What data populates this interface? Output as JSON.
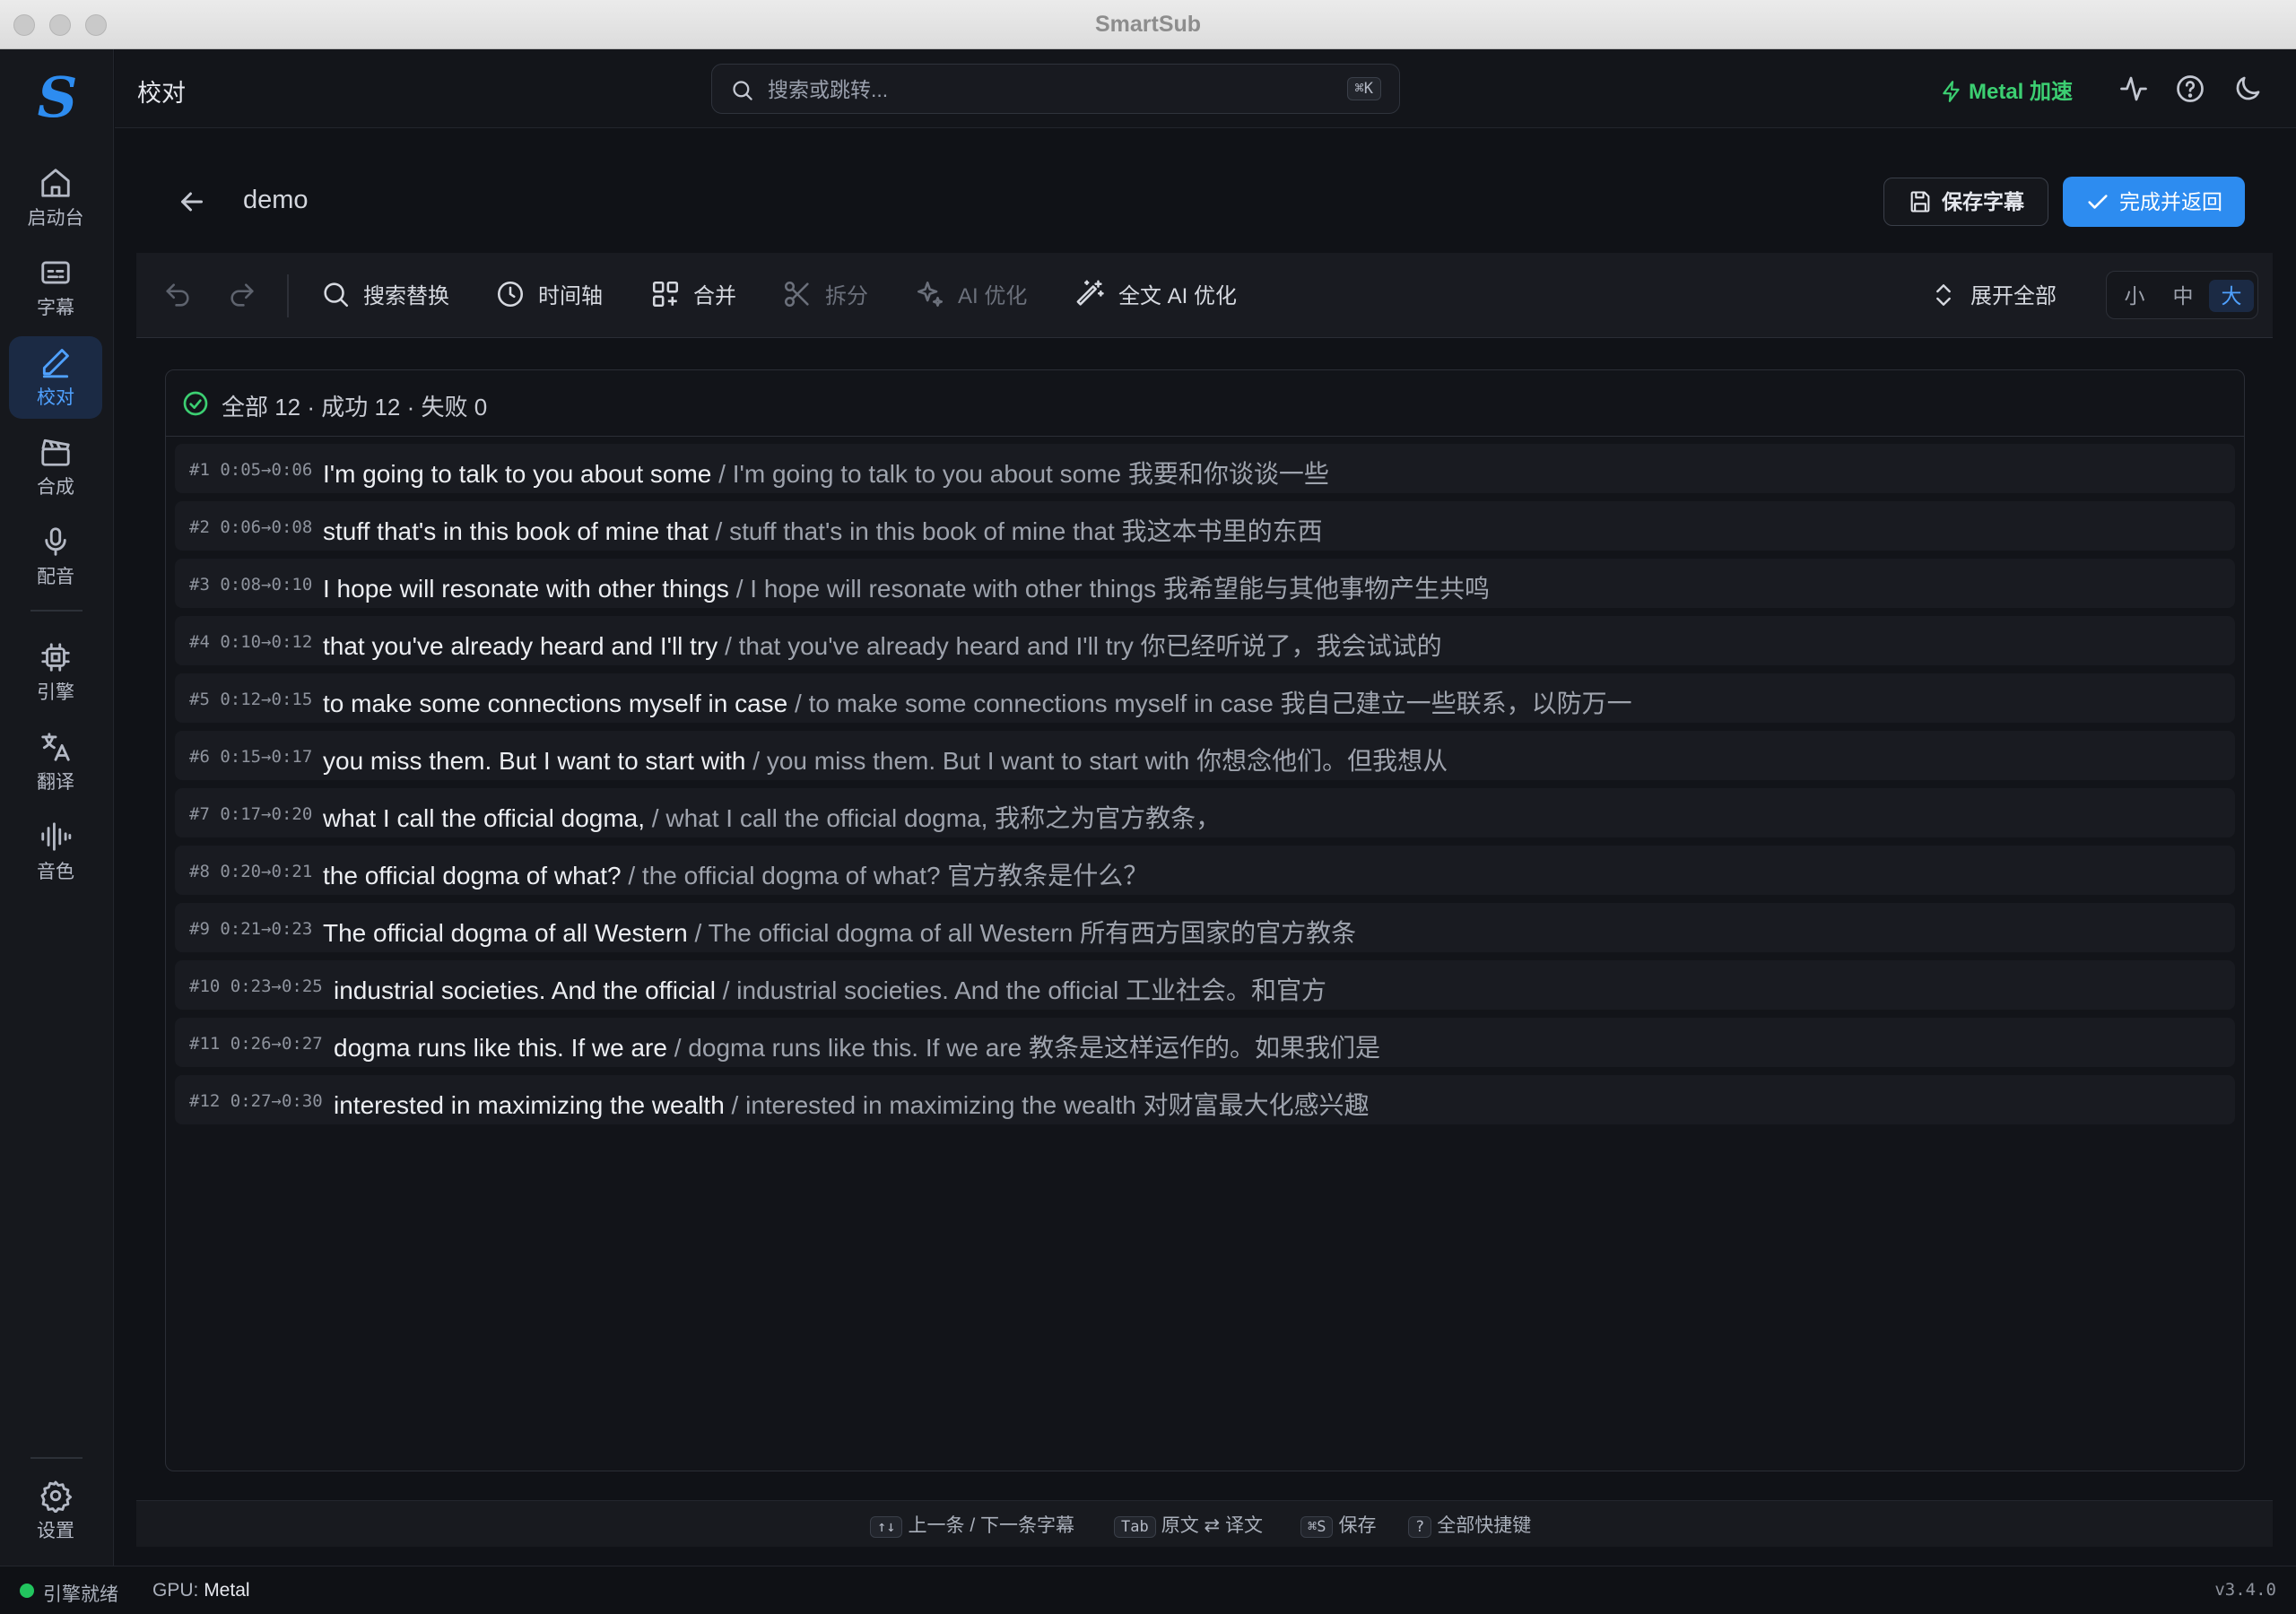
{
  "window": {
    "title": "SmartSub"
  },
  "sidebar": {
    "items": [
      {
        "label": "启动台",
        "icon": "home-icon"
      },
      {
        "label": "字幕",
        "icon": "subtitles-icon"
      },
      {
        "label": "校对",
        "icon": "pencil-icon",
        "active": true
      },
      {
        "label": "合成",
        "icon": "clapperboard-icon"
      },
      {
        "label": "配音",
        "icon": "microphone-icon"
      },
      {
        "label": "引擎",
        "icon": "cpu-chip-icon"
      },
      {
        "label": "翻译",
        "icon": "translate-icon"
      },
      {
        "label": "音色",
        "icon": "audio-lines-icon"
      }
    ],
    "settings_label": "设置"
  },
  "header": {
    "title": "校对",
    "search": {
      "placeholder": "搜索或跳转...",
      "shortcut": "⌘K"
    },
    "accel_label": "Metal 加速",
    "accel_color": "#3ccf72"
  },
  "project": {
    "name": "demo",
    "save_label": "保存字幕",
    "done_label": "完成并返回",
    "accent_color": "#2d8cf0"
  },
  "toolbar": {
    "search_replace": "搜索替换",
    "timeline": "时间轴",
    "merge": "合并",
    "split": "拆分",
    "ai_optimize": "AI 优化",
    "full_ai_optimize": "全文 AI 优化",
    "expand_all": "展开全部",
    "sizes": [
      "小",
      "中",
      "大"
    ],
    "selected_size": "大"
  },
  "summary": {
    "text": "全部 12 · 成功 12 · 失败 0"
  },
  "subtitles": [
    {
      "index": "#1",
      "time": "0:05→0:06",
      "source": "I'm going to talk to you about some",
      "translation": "/ I'm going to talk to you about some 我要和你谈谈一些"
    },
    {
      "index": "#2",
      "time": "0:06→0:08",
      "source": "stuff that's in this book of mine that",
      "translation": "/ stuff that's in this book of mine that 我这本书里的东西"
    },
    {
      "index": "#3",
      "time": "0:08→0:10",
      "source": "I hope will resonate with other things",
      "translation": "/ I hope will resonate with other things 我希望能与其他事物产生共鸣"
    },
    {
      "index": "#4",
      "time": "0:10→0:12",
      "source": "that you've already heard and I'll try",
      "translation": "/ that you've already heard and I'll try 你已经听说了，我会试试的"
    },
    {
      "index": "#5",
      "time": "0:12→0:15",
      "source": "to make some connections myself in case",
      "translation": "/ to make some connections myself in case 我自己建立一些联系，以防万一"
    },
    {
      "index": "#6",
      "time": "0:15→0:17",
      "source": "you miss them. But I want to start with",
      "translation": "/ you miss them. But I want to start with 你想念他们。但我想从"
    },
    {
      "index": "#7",
      "time": "0:17→0:20",
      "source": "what I call the official dogma,",
      "translation": "/ what I call the official dogma, 我称之为官方教条，"
    },
    {
      "index": "#8",
      "time": "0:20→0:21",
      "source": "the official dogma of what?",
      "translation": "/ the official dogma of what? 官方教条是什么？"
    },
    {
      "index": "#9",
      "time": "0:21→0:23",
      "source": "The official dogma of all Western",
      "translation": "/ The official dogma of all Western 所有西方国家的官方教条"
    },
    {
      "index": "#10",
      "time": "0:23→0:25",
      "source": "industrial societies. And the official",
      "translation": "/ industrial societies. And the official 工业社会。和官方"
    },
    {
      "index": "#11",
      "time": "0:26→0:27",
      "source": "dogma runs like this. If we are",
      "translation": "/ dogma runs like this. If we are 教条是这样运作的。如果我们是"
    },
    {
      "index": "#12",
      "time": "0:27→0:30",
      "source": "interested in maximizing the wealth",
      "translation": "/ interested in maximizing the wealth 对财富最大化感兴趣"
    }
  ],
  "footer": {
    "nav_keys": "↑↓",
    "nav_label": "上一条 / 下一条字幕",
    "toggle_key": "Tab",
    "toggle_label": "原文 ⇄ 译文",
    "save_key": "⌘S",
    "save_label": "保存",
    "help_key": "?",
    "help_label": "全部快捷键"
  },
  "status": {
    "engine_label": "引擎就绪",
    "engine_color": "#22c55e",
    "gpu_prefix": "GPU:",
    "gpu_value": "Metal",
    "version": "v3.4.0"
  }
}
